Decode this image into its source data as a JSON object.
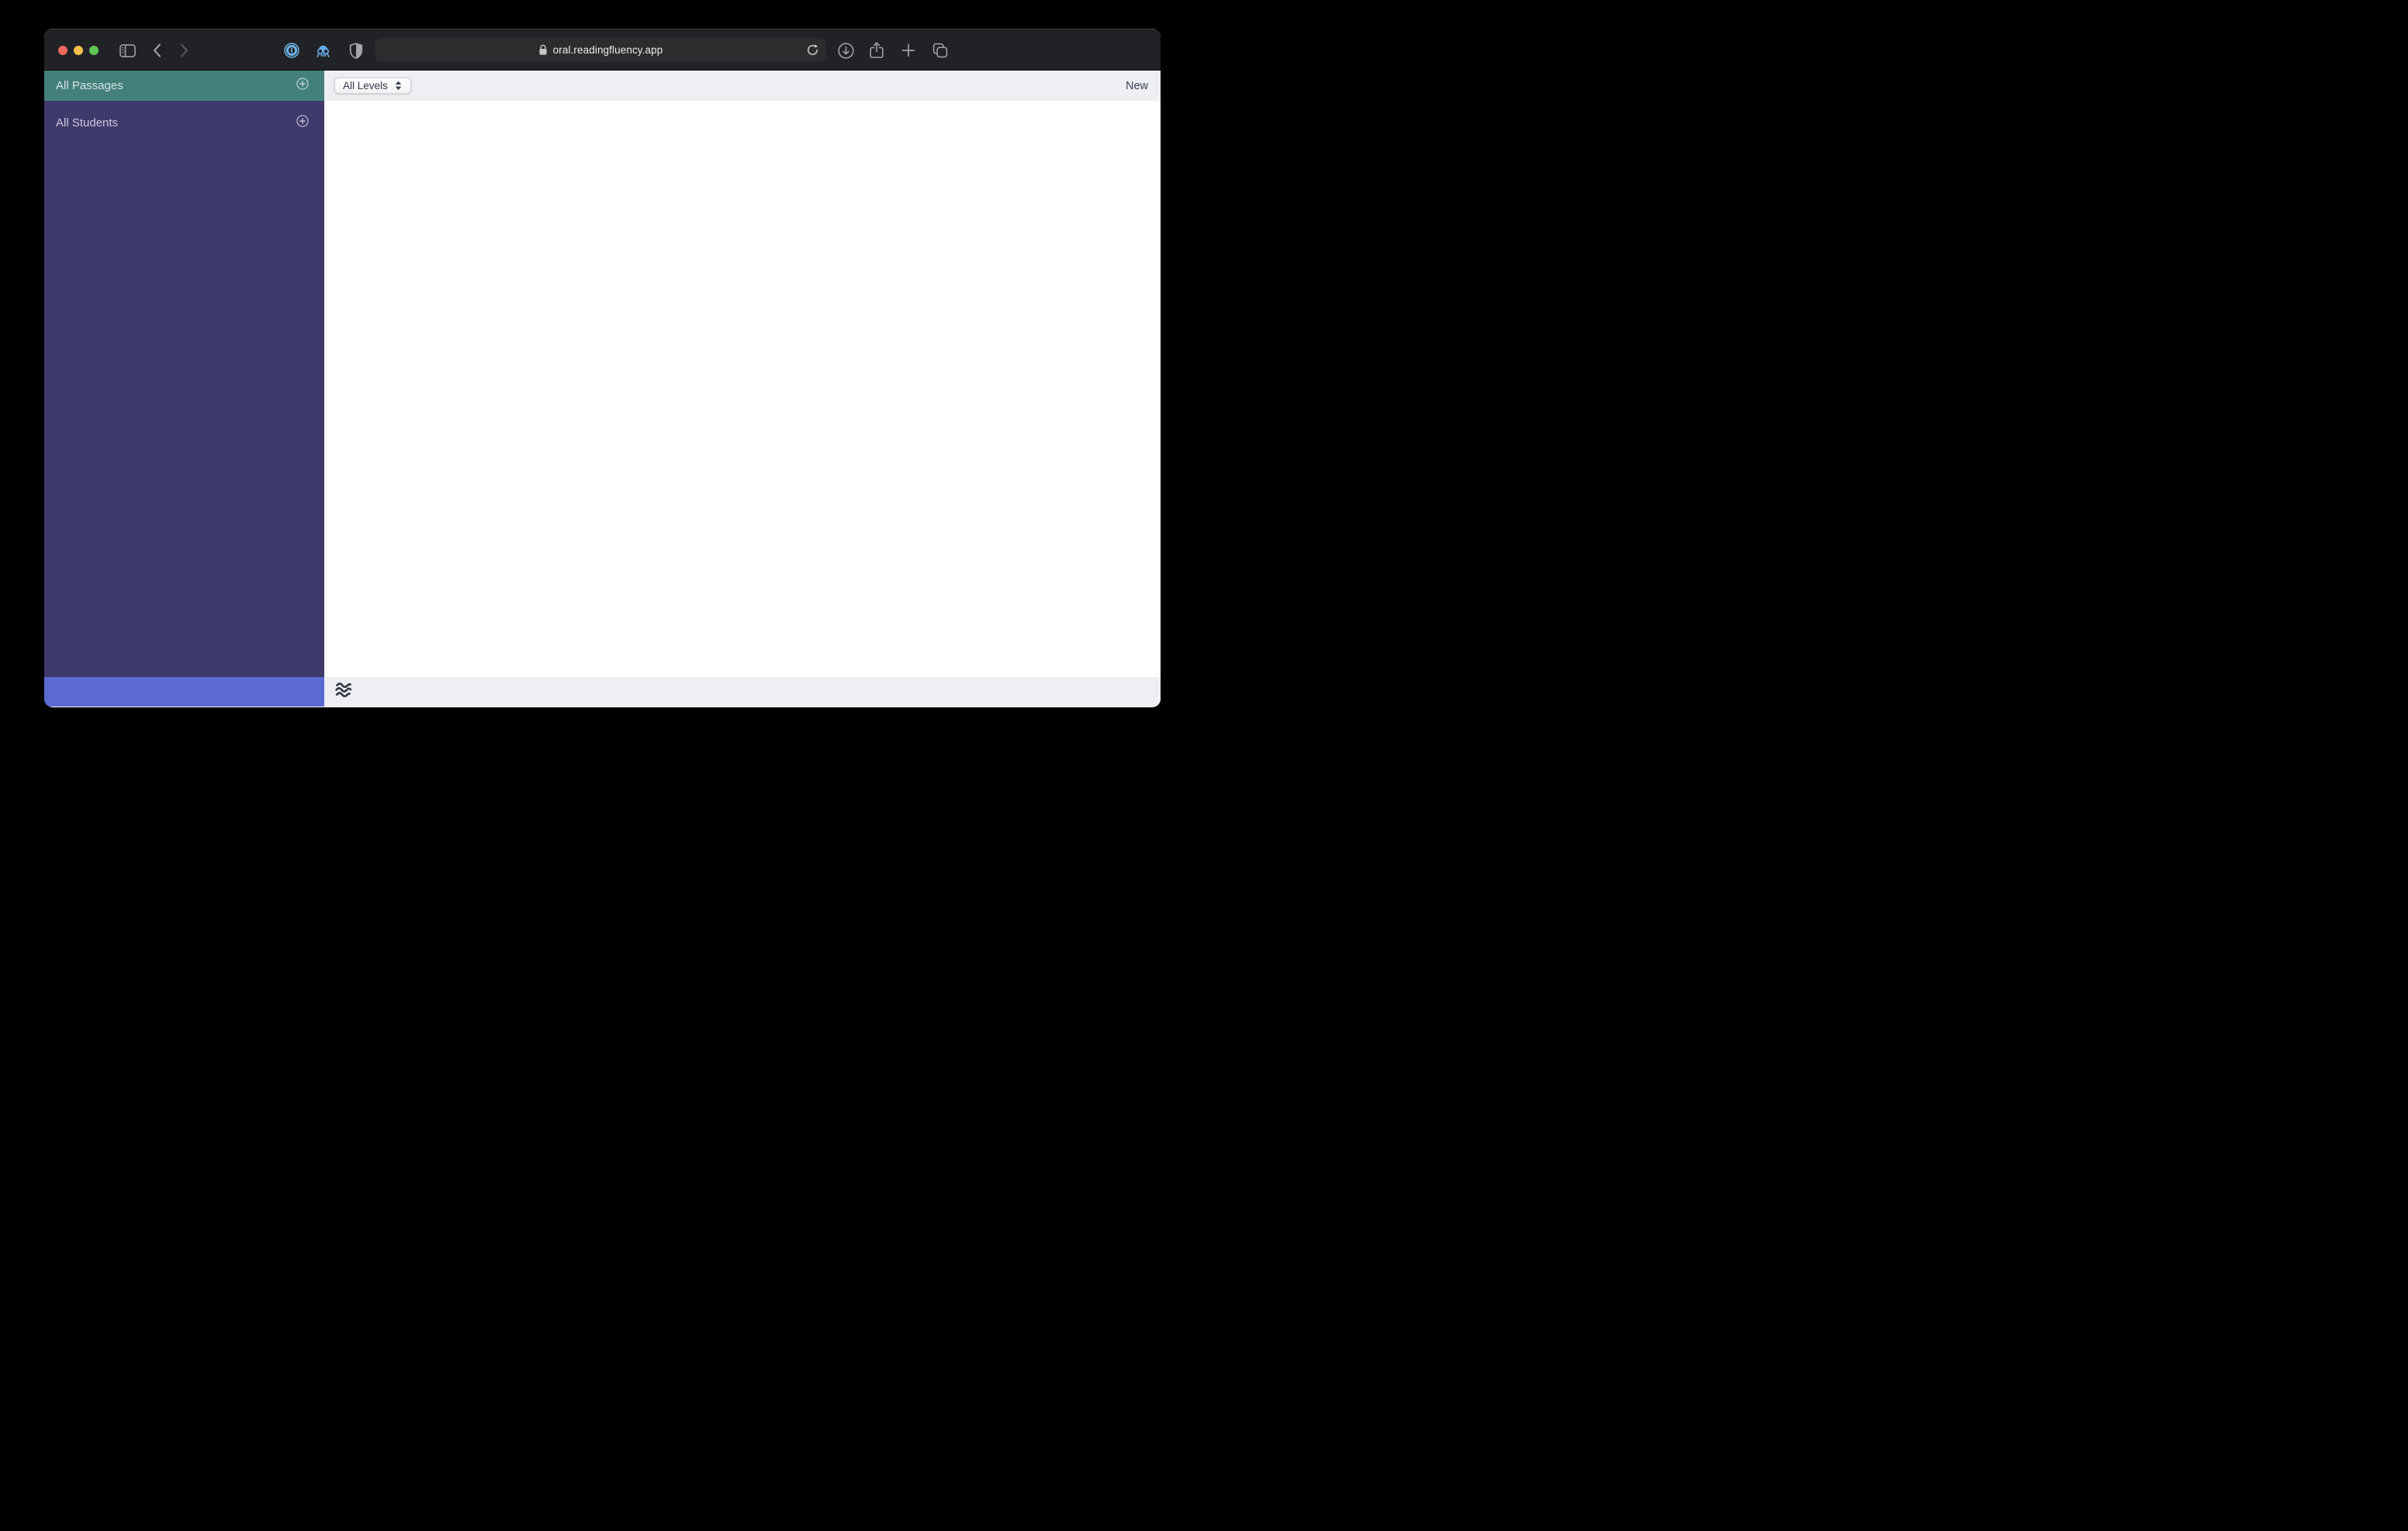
{
  "browser": {
    "url": "oral.readingfluency.app"
  },
  "sidebar": {
    "items": [
      {
        "label": "All Passages",
        "selected": true
      },
      {
        "label": "All Students",
        "selected": false
      }
    ]
  },
  "main": {
    "toolbar": {
      "level_filter_value": "All Levels",
      "new_label": "New"
    }
  },
  "icons": {
    "extensions": [
      "onepassword-icon",
      "octopus-extension-icon",
      "shield-extension-icon"
    ],
    "bottom": "waves-icon"
  },
  "colors": {
    "chrome_dark": "#212225",
    "accent_teal": "#44807b",
    "sidebar_purple": "#3f3a6c",
    "footer_blue": "#5a6ad0",
    "toolbar_gray": "#edeff3",
    "traffic_red": "#ec6a5e",
    "traffic_yellow": "#f5bf4f",
    "traffic_green": "#61c554"
  }
}
